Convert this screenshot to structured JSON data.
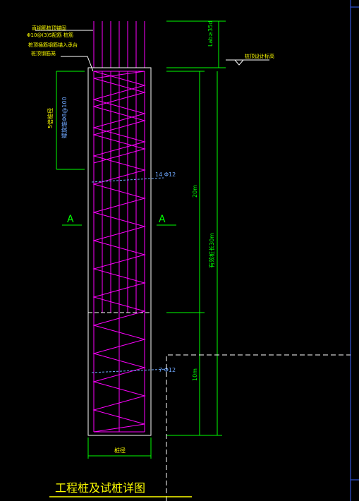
{
  "drawing": {
    "title": "工程桩及试桩详图",
    "note_lines": [
      "直钢筋桩顶锚固",
      "Φ10@(3)S配筋 桩筋",
      "桩顶插筋钢筋锚入承台",
      "桩顶钢筋笼"
    ],
    "anchorage_label": "Lab≥35d",
    "design_elevation_label": "桩顶设计标高",
    "stirrup_top_label": "5倍桩径",
    "stirrup_top_spec": "螺旋箍Φ8@100",
    "rebar_label_upper": "14 Φ12",
    "rebar_label_lower": "7 Φ12",
    "section_mark_left": "A",
    "section_mark_right": "A",
    "length_upper": "20m",
    "length_total": "有效桩长30m",
    "length_lower": "10m",
    "pile_diameter_label": "桩径"
  },
  "colors": {
    "background": "#000000",
    "outline": "#ffffff",
    "stirrup": "#ff00ff",
    "dimension": "#00ff00",
    "annotation": "#ffff00",
    "marker": "#6fa8ff",
    "border": "#3a64ff"
  }
}
